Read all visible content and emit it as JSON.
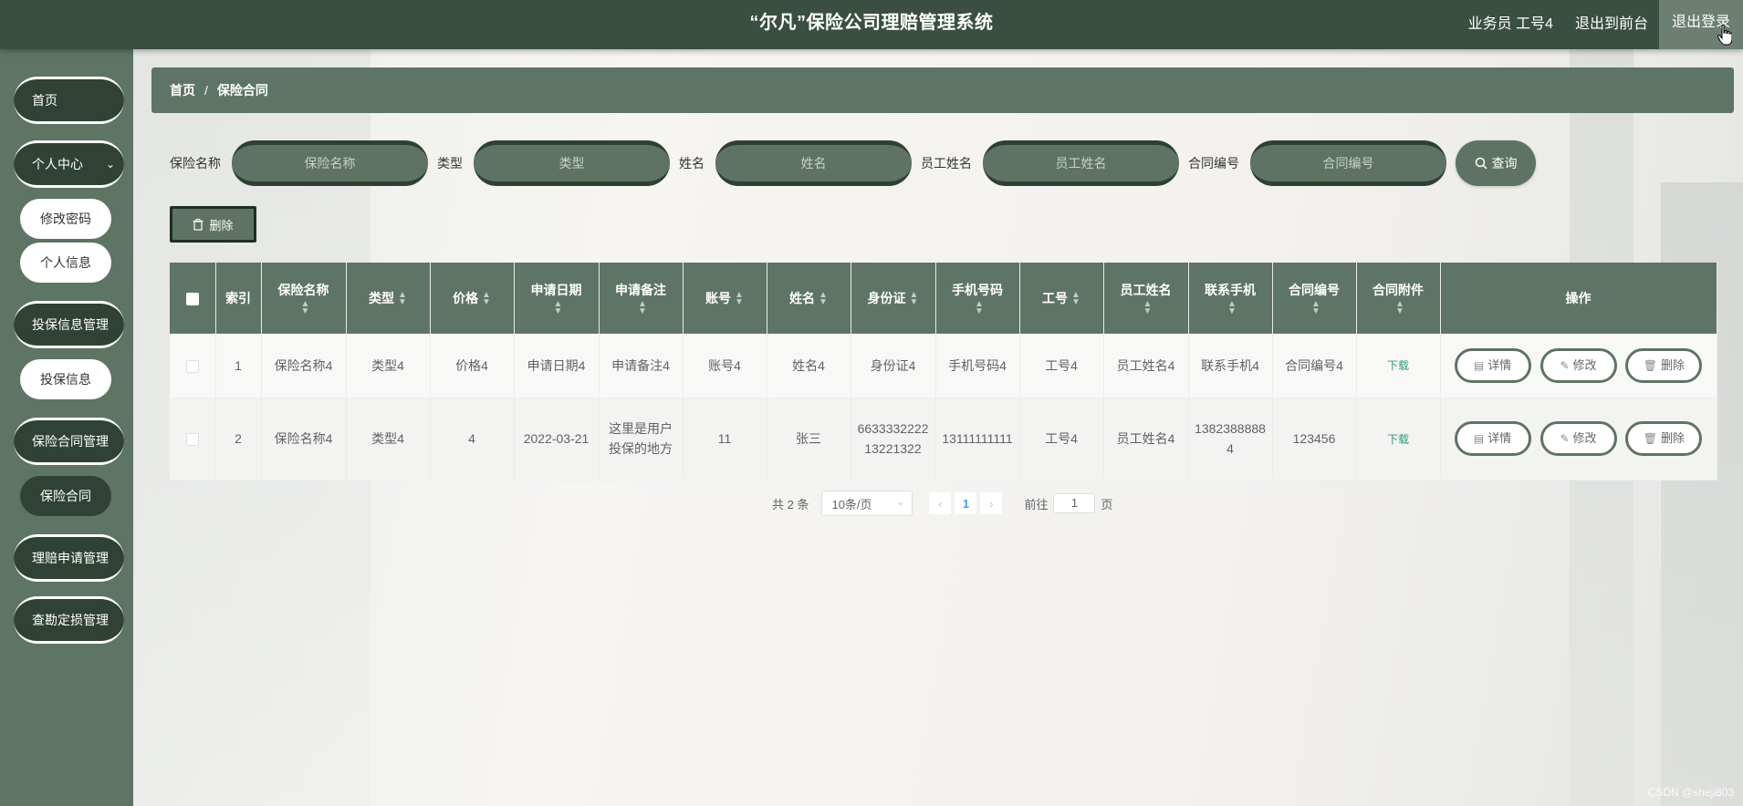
{
  "header": {
    "title": "“尔凡”保险公司理赔管理系统",
    "user": "业务员 工号4",
    "back_front": "退出到前台",
    "logout": "退出登录"
  },
  "sidebar": {
    "home": "首页",
    "personal_center": "个人中心",
    "change_password": "修改密码",
    "personal_info": "个人信息",
    "insure_mgmt": "投保信息管理",
    "insure_info": "投保信息",
    "contract_mgmt": "保险合同管理",
    "contract": "保险合同",
    "claim_mgmt": "理赔申请管理",
    "survey_mgmt": "查勘定损管理"
  },
  "breadcrumb": {
    "home": "首页",
    "sep": "/",
    "current": "保险合同"
  },
  "search": {
    "f1_label": "保险名称",
    "f1_placeholder": "保险名称",
    "f2_label": "类型",
    "f2_placeholder": "类型",
    "f3_label": "姓名",
    "f3_placeholder": "姓名",
    "f4_label": "员工姓名",
    "f4_placeholder": "员工姓名",
    "f5_label": "合同编号",
    "f5_placeholder": "合同编号",
    "query": "查询"
  },
  "toolbar": {
    "delete": "删除"
  },
  "table": {
    "headers": [
      "索引",
      "保险名称",
      "类型",
      "价格",
      "申请日期",
      "申请备注",
      "账号",
      "姓名",
      "身份证",
      "手机号码",
      "工号",
      "员工姓名",
      "联系手机",
      "合同编号",
      "合同附件",
      "操作"
    ],
    "rows": [
      [
        "1",
        "保险名称4",
        "类型4",
        "价格4",
        "申请日期4",
        "申请备注4",
        "账号4",
        "姓名4",
        "身份证4",
        "手机号码4",
        "工号4",
        "员工姓名4",
        "联系手机4",
        "合同编号4",
        "下载"
      ],
      [
        "2",
        "保险名称4",
        "类型4",
        "4",
        "2022-03-21",
        "这里是用户投保的地方",
        "11",
        "张三",
        "663333222213221322",
        "13111111111",
        "工号4",
        "员工姓名4",
        "13823888884",
        "123456",
        "下载"
      ]
    ],
    "actions": {
      "detail": "详情",
      "edit": "修改",
      "delete": "删除"
    }
  },
  "pager": {
    "total": "共 2 条",
    "page_size": "10条/页",
    "current_page": "1",
    "goto_label": "前往",
    "goto_value": "1",
    "page_suffix": "页"
  },
  "watermark": "CSDN @sheji803",
  "colors": {
    "header_bg": "#3a4e42",
    "sidebar_bg": "#5e7465",
    "accent": "#5e7364",
    "dark": "#2f4235"
  }
}
